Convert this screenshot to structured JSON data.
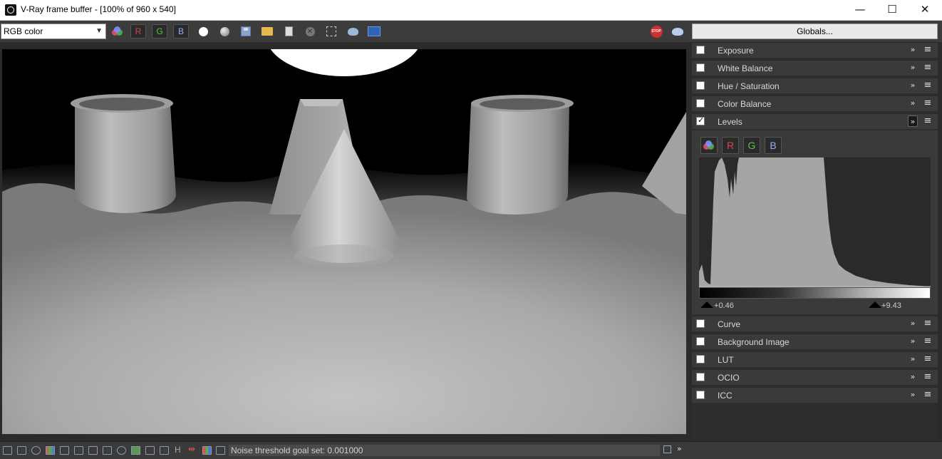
{
  "window": {
    "title": "V-Ray frame buffer - [100% of 960 x 540]",
    "minimize_glyph": "—",
    "maximize_glyph": "☐",
    "close_glyph": "✕"
  },
  "toolbar": {
    "channel_value": "RGB color",
    "r_label": "R",
    "g_label": "G",
    "b_label": "B",
    "globals_label": "Globals...",
    "stop_label": "STOP"
  },
  "corrections": [
    {
      "label": "Exposure",
      "checked": false
    },
    {
      "label": "White Balance",
      "checked": false
    },
    {
      "label": "Hue / Saturation",
      "checked": false
    },
    {
      "label": "Color Balance",
      "checked": false
    },
    {
      "label": "Levels",
      "checked": true
    },
    {
      "label": "Curve",
      "checked": false
    },
    {
      "label": "Background Image",
      "checked": false
    },
    {
      "label": "LUT",
      "checked": false
    },
    {
      "label": "OCIO",
      "checked": false
    },
    {
      "label": "ICC",
      "checked": false
    }
  ],
  "levels": {
    "r_label": "R",
    "g_label": "G",
    "b_label": "B",
    "low_value": "0.46",
    "high_value": "9.43"
  },
  "status": {
    "message": "Noise threshold goal set: 0.001000",
    "h_label": "H"
  },
  "colors": {
    "accent_red": "#e04050",
    "accent_green": "#60c040",
    "accent_blue": "#9aa8ff"
  }
}
